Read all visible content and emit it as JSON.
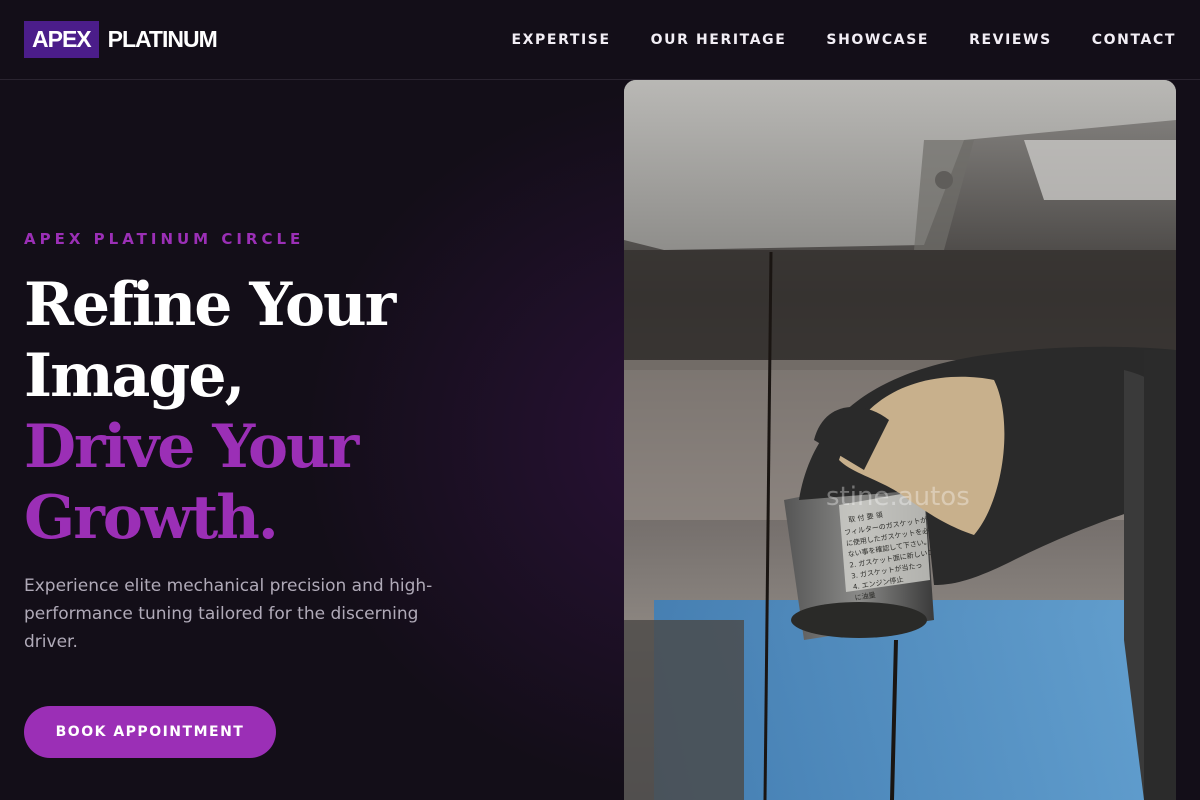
{
  "brand": {
    "box": "APEX",
    "text": "PLATINUM"
  },
  "nav": [
    {
      "label": "EXPERTISE"
    },
    {
      "label": "OUR HERITAGE"
    },
    {
      "label": "SHOWCASE"
    },
    {
      "label": "REVIEWS"
    },
    {
      "label": "CONTACT"
    }
  ],
  "hero": {
    "eyebrow": "APEX PLATINUM CIRCLE",
    "headline_line1": "Refine Your",
    "headline_line2": "Image,",
    "headline_line3": "Drive Your",
    "headline_line4": "Growth.",
    "description": "Experience elite mechanical precision and high-performance tuning tailored for the discerning driver.",
    "cta_label": "BOOK APPOINTMENT"
  },
  "photo": {
    "watermark": "stine.autos",
    "filter_label_lines": [
      "取 付 要 領",
      "フィルターのガスケットが部品につ",
      "に使用したガスケットを必ずエンジ",
      "ない事を確認して下さい。",
      "2. ガスケット面に新しいエン",
      "3. ガスケットが当たっ",
      "4. エンジン停止",
      "に油量"
    ]
  },
  "colors": {
    "background": "#130e18",
    "accent": "#9b2fb6",
    "logo_box": "#4b1d8a"
  }
}
